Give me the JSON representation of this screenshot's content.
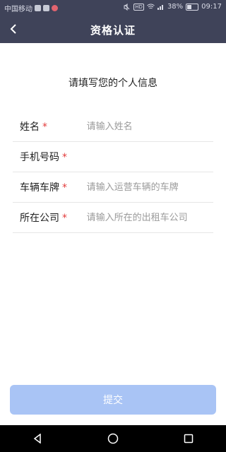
{
  "status_bar": {
    "carrier": "中国移动",
    "battery": "38%",
    "time": "09:17",
    "icons": [
      "message-icon",
      "chat-icon",
      "heart-icon",
      "mute-icon",
      "hd-icon",
      "wifi-icon",
      "signal-icon",
      "battery-icon"
    ]
  },
  "nav": {
    "title": "资格认证",
    "back_icon": "chevron-left-icon"
  },
  "subtitle": "请填写您的个人信息",
  "form": {
    "fields": [
      {
        "label": "姓名",
        "required_mark": "*",
        "placeholder": "请输入姓名",
        "value": ""
      },
      {
        "label": "手机号码",
        "required_mark": "*",
        "placeholder": "",
        "value": ""
      },
      {
        "label": "车辆车牌",
        "required_mark": "*",
        "placeholder": "请输入运营车辆的车牌",
        "value": ""
      },
      {
        "label": "所在公司",
        "required_mark": "*",
        "placeholder": "请输入所在的出租车公司",
        "value": ""
      }
    ]
  },
  "submit_label": "提交",
  "colors": {
    "header": "#3f4359",
    "button": "#a9c4f5",
    "required": "#e23b3b"
  },
  "system_nav": [
    "back-triangle-icon",
    "home-circle-icon",
    "recents-square-icon"
  ]
}
